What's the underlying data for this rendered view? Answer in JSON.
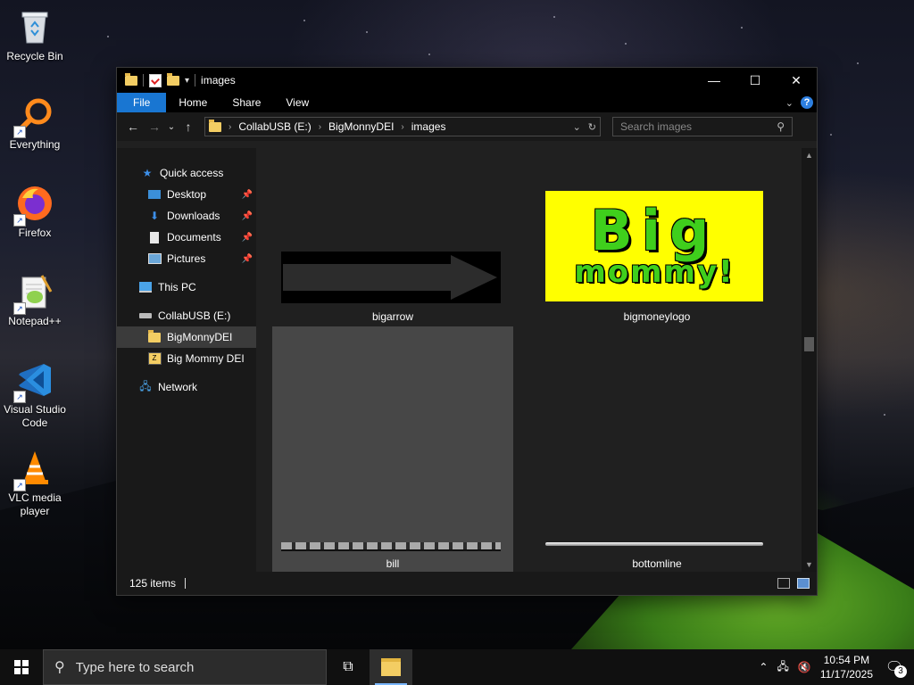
{
  "desktop": {
    "icons": [
      {
        "label": "Recycle Bin",
        "icon": "recycle-bin-icon"
      },
      {
        "label": "Everything",
        "icon": "everything-search-icon"
      },
      {
        "label": "Firefox",
        "icon": "firefox-icon"
      },
      {
        "label": "Notepad++",
        "icon": "notepad-plus-plus-icon"
      },
      {
        "label": "Visual Studio Code",
        "icon": "vscode-icon"
      },
      {
        "label": "VLC media player",
        "icon": "vlc-icon"
      }
    ]
  },
  "window": {
    "title": "images",
    "controls": {
      "minimize": "—",
      "maximize": "☐",
      "close": "✕"
    },
    "ribbon": {
      "file": "File",
      "home": "Home",
      "share": "Share",
      "view": "View",
      "help": "?"
    },
    "breadcrumb": [
      "CollabUSB (E:)",
      "BigMonnyDEI",
      "images"
    ],
    "search_placeholder": "Search images",
    "nav_pane": {
      "quick_access": "Quick access",
      "pinned": [
        "Desktop",
        "Downloads",
        "Documents",
        "Pictures"
      ],
      "this_pc": "This PC",
      "drive": "CollabUSB (E:)",
      "folders": [
        "BigMonnyDEI",
        "Big Mommy DEI"
      ],
      "network": "Network"
    },
    "items": [
      {
        "name": "bigarrow"
      },
      {
        "name": "bigmoneylogo",
        "logo_text_line1": "Big",
        "logo_text_line2": "mommy!"
      },
      {
        "name": "bill"
      },
      {
        "name": "bottomline"
      }
    ],
    "status": {
      "count": "125 items"
    }
  },
  "taskbar": {
    "search_placeholder": "Type here to search",
    "time": "10:54 PM",
    "date": "11/17/2025",
    "notification_count": "3"
  },
  "colors": {
    "file_tab": "#1976d2",
    "logo_background": "#ffff00",
    "logo_text": "#3fcf1c",
    "selection": "#3b3b3b"
  }
}
